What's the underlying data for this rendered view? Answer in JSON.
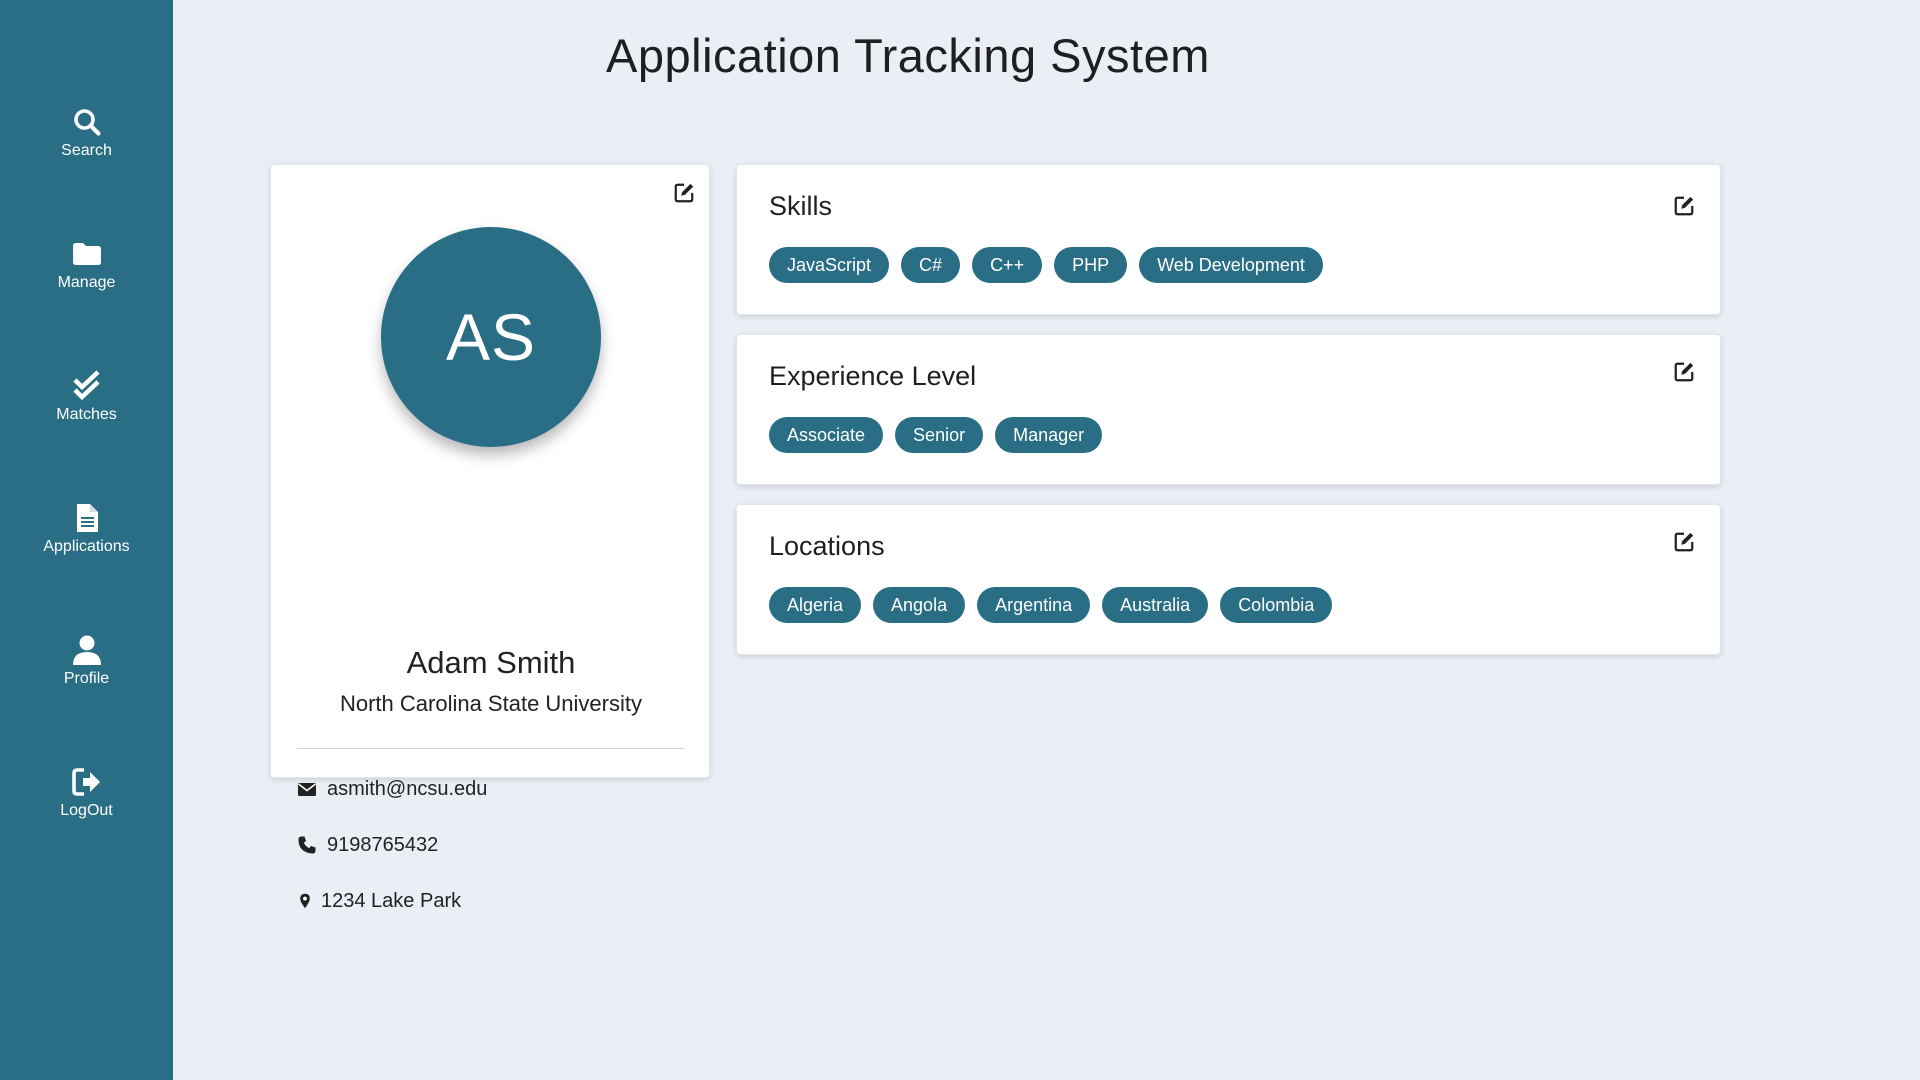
{
  "app": {
    "title": "Application Tracking System"
  },
  "nav": {
    "items": [
      {
        "label": "Search",
        "icon": "search-icon"
      },
      {
        "label": "Manage",
        "icon": "folder-icon"
      },
      {
        "label": "Matches",
        "icon": "double-check-icon"
      },
      {
        "label": "Applications",
        "icon": "document-icon"
      },
      {
        "label": "Profile",
        "icon": "user-icon"
      },
      {
        "label": "LogOut",
        "icon": "sign-out-icon"
      }
    ]
  },
  "profile": {
    "initials": "AS",
    "name": "Adam Smith",
    "university": "North Carolina State University",
    "email": "asmith@ncsu.edu",
    "phone": "9198765432",
    "address": "1234 Lake Park"
  },
  "sections": [
    {
      "title": "Skills",
      "tags": [
        "JavaScript",
        "C#",
        "C++",
        "PHP",
        "Web Development"
      ]
    },
    {
      "title": "Experience Level",
      "tags": [
        "Associate",
        "Senior",
        "Manager"
      ]
    },
    {
      "title": "Locations",
      "tags": [
        "Algeria",
        "Angola",
        "Argentina",
        "Australia",
        "Colombia"
      ]
    }
  ],
  "colors": {
    "accent": "#296e85",
    "background": "#eaeef5",
    "card": "#ffffff"
  }
}
